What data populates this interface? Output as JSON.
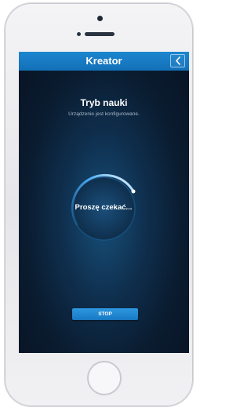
{
  "header": {
    "title": "Kreator",
    "back_icon": "chevron-left-icon"
  },
  "main": {
    "mode_title": "Tryb nauki",
    "mode_subtitle": "Urządzenie jest konfigurowane.",
    "spinner_label": "Proszę czekać...",
    "stop_label": "STOP"
  },
  "colors": {
    "accent": "#1a7fca",
    "background": "#0b1e33",
    "glow": "#4fb6ff"
  }
}
